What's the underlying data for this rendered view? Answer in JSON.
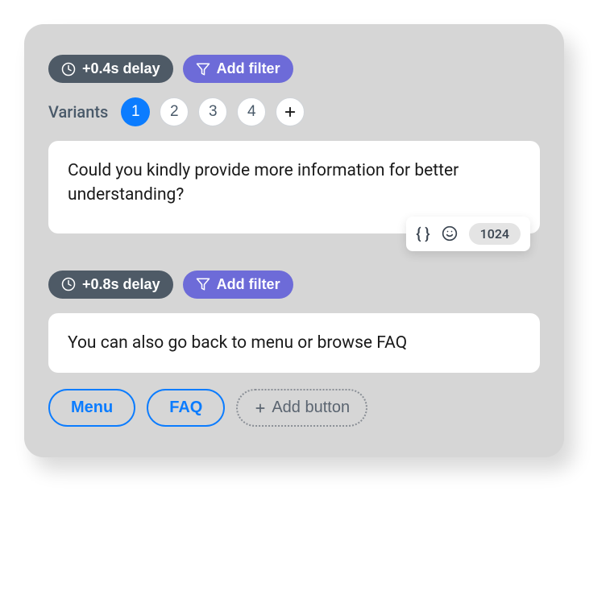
{
  "section1": {
    "delay_label": "+0.4s delay",
    "add_filter_label": "Add filter",
    "variants_label": "Variants",
    "variants": [
      "1",
      "2",
      "3",
      "4"
    ],
    "active_variant_index": 0,
    "message": "Could you kindly provide more information for better understanding?",
    "toolbar": {
      "braces": "{ }",
      "count": "1024"
    }
  },
  "section2": {
    "delay_label": "+0.8s delay",
    "add_filter_label": "Add filter",
    "message": "You can also go back to menu or browse FAQ",
    "buttons": [
      "Menu",
      "FAQ"
    ],
    "add_button_label": "Add button"
  }
}
